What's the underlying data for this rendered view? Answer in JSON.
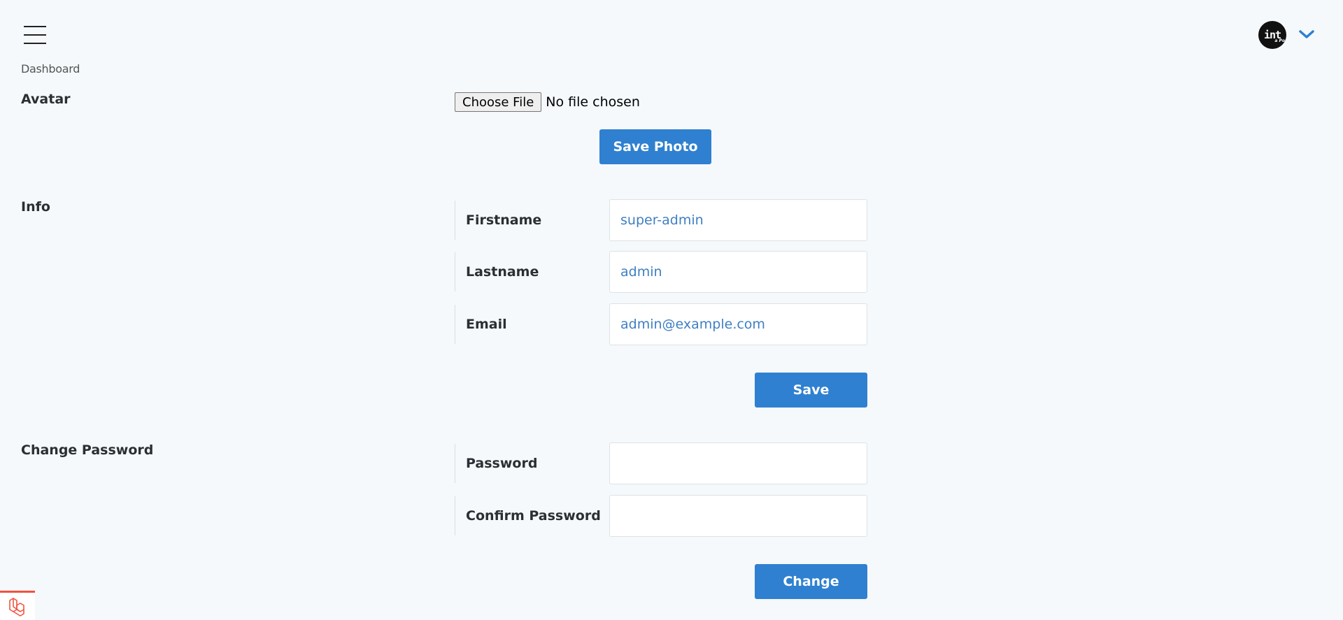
{
  "header": {
    "menu_icon": "hamburger-menu-icon",
    "avatar_text": "int",
    "avatar_small_text": "a Po",
    "dropdown_icon": "chevron-down-icon",
    "accent": "#2f80d0"
  },
  "breadcrumb": {
    "current": "Dashboard"
  },
  "avatar_section": {
    "title": "Avatar",
    "file_button_label": "Choose File",
    "file_status": "No file chosen",
    "save_photo_label": "Save Photo"
  },
  "info_section": {
    "title": "Info",
    "fields": [
      {
        "label": "Firstname",
        "value": "super-admin"
      },
      {
        "label": "Lastname",
        "value": "admin"
      },
      {
        "label": "Email",
        "value": "admin@example.com"
      }
    ],
    "save_label": "Save"
  },
  "password_section": {
    "title": "Change Password",
    "fields": [
      {
        "label": "Password",
        "value": ""
      },
      {
        "label": "Confirm Password",
        "value": ""
      }
    ],
    "change_label": "Change"
  },
  "footer": {
    "debug_icon": "laravel-logo-icon",
    "debug_color": "#f05340"
  }
}
